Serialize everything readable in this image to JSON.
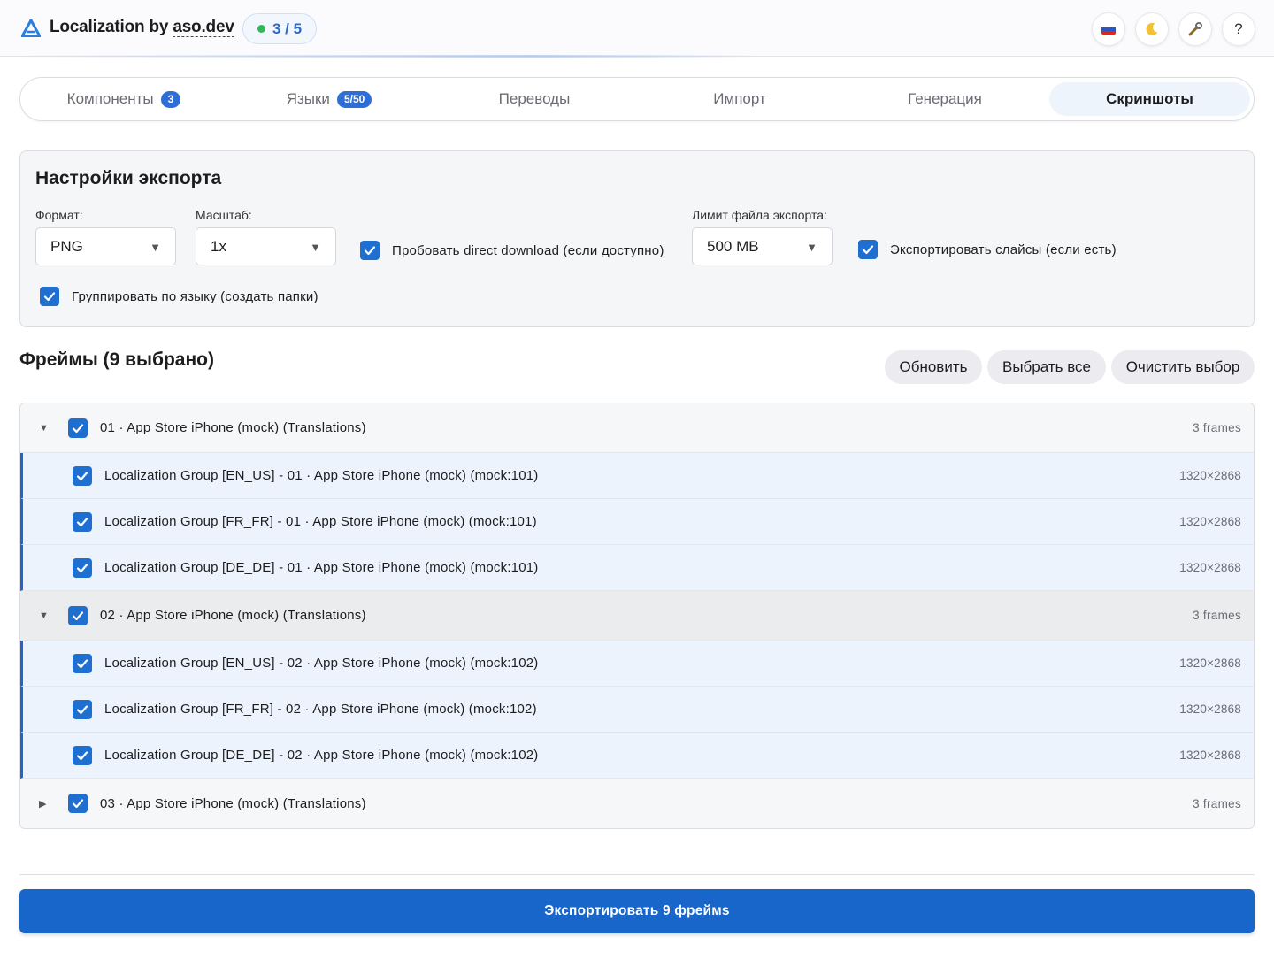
{
  "header": {
    "app_title_prefix": "Localization by ",
    "app_title_brand": "aso.dev",
    "step_progress": "3 / 5",
    "step_status_color": "#2fb85a",
    "buttons": [
      {
        "name": "language-ru",
        "icon": "flag-ru-icon"
      },
      {
        "name": "theme-toggle",
        "icon": "moon-icon"
      },
      {
        "name": "tools",
        "icon": "wrench-icon"
      },
      {
        "name": "help",
        "label": "?"
      }
    ]
  },
  "tabs": [
    {
      "label": "Компоненты",
      "badge": "3",
      "active": false
    },
    {
      "label": "Языки",
      "badge": "5/50",
      "active": false
    },
    {
      "label": "Переводы",
      "active": false
    },
    {
      "label": "Импорт",
      "active": false
    },
    {
      "label": "Генерация",
      "active": false
    },
    {
      "label": "Скриншоты",
      "active": true
    }
  ],
  "settings": {
    "title": "Настройки экспорта",
    "format_label": "Формат:",
    "format_value": "PNG",
    "scale_label": "Масштаб:",
    "scale_value": "1x",
    "direct_download_label": "Пробовать direct download (если доступно)",
    "direct_download_checked": true,
    "file_limit_label": "Лимит файла экспорта:",
    "file_limit_value": "500 MB",
    "slices_label": "Экспортировать слайсы (если есть)",
    "slices_checked": true,
    "group_by_lang_label": "Группировать по языку (создать папки)",
    "group_by_lang_checked": true
  },
  "frames": {
    "title": "Фреймы (9 выбрано)",
    "refresh_label": "Обновить",
    "select_all_label": "Выбрать все",
    "clear_label": "Очистить выбор",
    "groups": [
      {
        "label": "01 · App Store iPhone (mock) (Translations)",
        "count": "3 frames",
        "expanded": true,
        "items": [
          {
            "label": "Localization Group [EN_US] - 01 · App Store iPhone (mock) (mock:101)",
            "size": "1320×2868"
          },
          {
            "label": "Localization Group [FR_FR] - 01 · App Store iPhone (mock) (mock:101)",
            "size": "1320×2868"
          },
          {
            "label": "Localization Group [DE_DE] - 01 · App Store iPhone (mock) (mock:101)",
            "size": "1320×2868"
          }
        ]
      },
      {
        "label": "02 · App Store iPhone (mock) (Translations)",
        "count": "3 frames",
        "expanded": true,
        "items": [
          {
            "label": "Localization Group [EN_US] - 02 · App Store iPhone (mock) (mock:102)",
            "size": "1320×2868"
          },
          {
            "label": "Localization Group [FR_FR] - 02 · App Store iPhone (mock) (mock:102)",
            "size": "1320×2868"
          },
          {
            "label": "Localization Group [DE_DE] - 02 · App Store iPhone (mock) (mock:102)",
            "size": "1320×2868"
          }
        ]
      },
      {
        "label": "03 · App Store iPhone (mock) (Translations)",
        "count": "3 frames",
        "expanded": false,
        "items": []
      }
    ]
  },
  "export_button_label": "Экспортировать 9 фреймs",
  "colors": {
    "accent": "#1866c9",
    "checkbox": "#1f6fd1",
    "badge": "#2d6fd6",
    "selected_row": "#ecf3fc"
  }
}
